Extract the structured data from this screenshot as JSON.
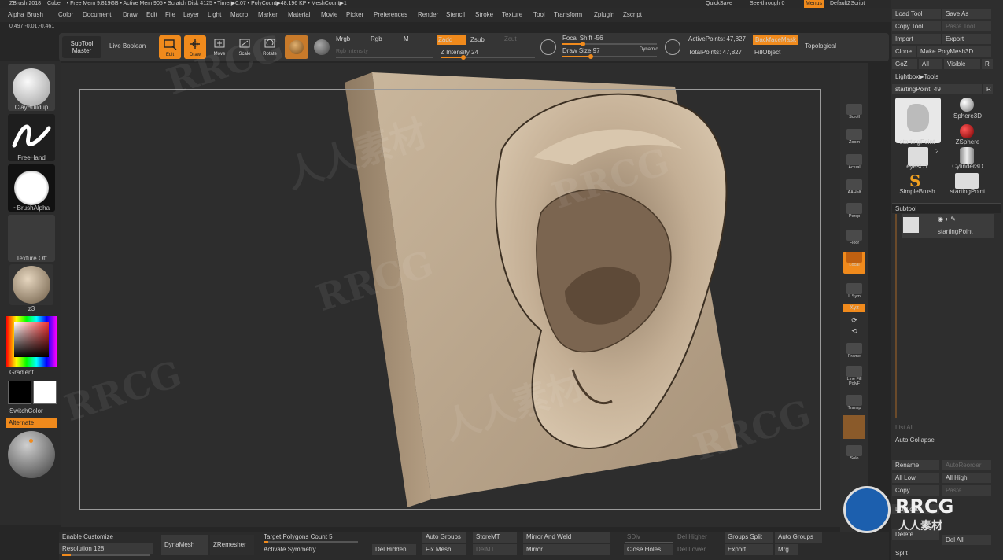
{
  "titlebar": {
    "items": [
      "ZBrush 2018",
      "Cube",
      "• Free Mem 9.819GB • Active Mem 905 • Scratch Disk 4125 • Timer▶0.07 • PolyCount▶48.196 KP • MeshCount▶1"
    ],
    "quicksave": "QuickSave",
    "seethrough": "See-through 0",
    "menus": "Menus",
    "script": "DefaultZScript"
  },
  "menubar": [
    "Alpha",
    "Brush",
    "Color",
    "Document",
    "Draw",
    "Edit",
    "File",
    "Layer",
    "Light",
    "Macro",
    "Marker",
    "Material",
    "Movie",
    "Picker",
    "Preferences",
    "Render",
    "Stencil",
    "Stroke",
    "Texture",
    "Tool",
    "Transform",
    "Zplugin",
    "Zscript"
  ],
  "coords": "0.497,-0.01,-0.461",
  "shelf": {
    "subtool_master": "SubTool Master",
    "live_boolean": "Live Boolean",
    "edit": "Edit",
    "draw": "Draw",
    "move": "Move",
    "scale": "Scale",
    "rotate": "Rotate",
    "mrgb": "Mrgb",
    "rgb": "Rgb",
    "m": "M",
    "rgb_intensity": "Rgb Intensity",
    "zadd": "Zadd",
    "zsub": "Zsub",
    "zcut": "Zcut",
    "z_intensity": "Z Intensity 24",
    "focal_shift": "Focal Shift -56",
    "draw_size": "Draw Size 97",
    "dynamic": "Dynamic",
    "active_points": "ActivePoints: 47,827",
    "total_points": "TotalPoints: 47,827",
    "backface_mask": "BackfaceMask",
    "fill_object": "FillObject",
    "topological": "Topological"
  },
  "shelf_values": {
    "z_intensity": 0.24,
    "focal_shift": -56,
    "draw_size": 0.3
  },
  "left": {
    "brush": "ClayBuildup",
    "stroke": "FreeHand",
    "alpha": "~BrushAlpha",
    "texture": "Texture Off",
    "material": "z3",
    "gradient": "Gradient",
    "switch_color": "SwitchColor",
    "alternate": "Alternate"
  },
  "right_shelf": [
    "Scroll",
    "Zoom",
    "Actual",
    "AAHalf",
    "Persp",
    "Floor",
    "Local",
    "L.Sym",
    "Xyz",
    "Frame",
    "Line Fill PolyF",
    "Transp",
    "Solo"
  ],
  "right_tray": {
    "load_tool": "Load Tool",
    "save_as": "Save As",
    "copy_tool": "Copy Tool",
    "paste_tool": "Paste Tool",
    "import": "Import",
    "export": "Export",
    "clone": "Clone",
    "make_polymesh": "Make PolyMesh3D",
    "goz": "GoZ",
    "all": "All",
    "visible": "Visible",
    "r": "R",
    "lightbox": "Lightbox▶Tools",
    "starting_point": "startingPoint. 49",
    "tools": [
      "startingPoint",
      "Sphere3D",
      "ZSphere",
      "eyesO1",
      "Cylinder3D",
      "SimpleBrush",
      "startingPoint"
    ],
    "eyes_count": "2",
    "subtool": "Subtool",
    "subtool_item": "startingPoint",
    "list_all": "List All",
    "auto_collapse": "Auto Collapse",
    "rename": "Rename",
    "auto_reorder": "AutoReorder",
    "all_low": "All Low",
    "all_high": "All High",
    "copy": "Copy",
    "paste": "Paste",
    "duplicate": "Duplicate",
    "delete": "Delete",
    "del_all": "Del All",
    "split": "Split"
  },
  "bottom": {
    "enable_customize": "Enable Customize",
    "resolution": "Resolution 128",
    "dynamesh": "DynaMesh",
    "zremesher": "ZRemesher",
    "target_polygons": "Target Polygons Count 5",
    "activate_symmetry": "Activate Symmetry",
    "del_hidden": "Del Hidden",
    "auto_groups": "Auto Groups",
    "fix_mesh": "Fix Mesh",
    "store_mt": "StoreMT",
    "del_mt": "DelMT",
    "mirror_and_weld": "Mirror And Weld",
    "mirror": "Mirror",
    "sdiv": "SDiv",
    "close_holes": "Close Holes",
    "del_higher": "Del Higher",
    "del_lower": "Del Lower",
    "groups_split": "Groups Split",
    "export": "Export",
    "auto_groups2": "Auto Groups",
    "mrg": "Mrg",
    "resolution_value": 0.1
  },
  "watermark": {
    "text1": "RRCG",
    "text2": "人人素材"
  },
  "logo": {
    "brand": "RRCG",
    "sub": "人人素材"
  },
  "colors": {
    "accent": "#f08a1c",
    "clay": "#c2ad92"
  }
}
